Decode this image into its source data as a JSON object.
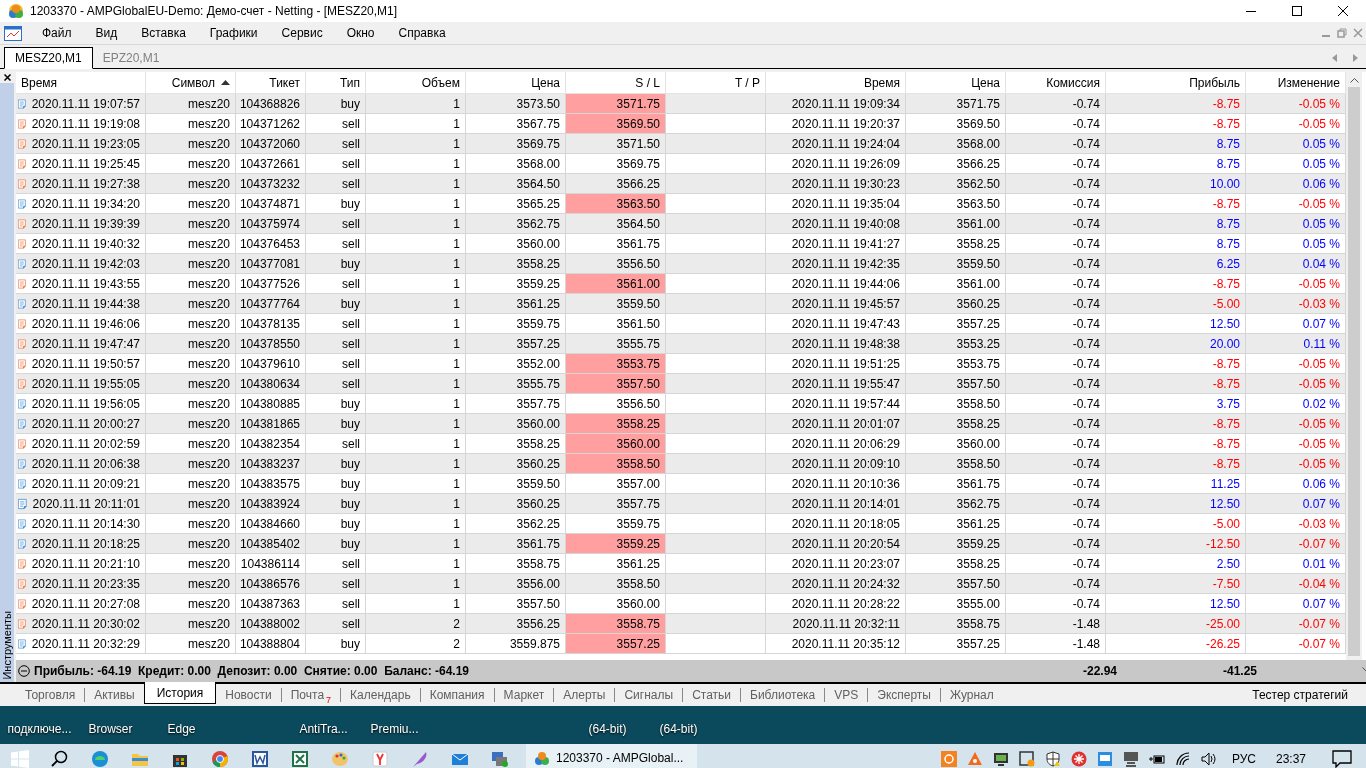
{
  "window": {
    "title": "1203370 - AMPGlobalEU-Demo: Демо-счет - Netting - [MESZ20,M1]"
  },
  "menu": [
    "Файл",
    "Вид",
    "Вставка",
    "Графики",
    "Сервис",
    "Окно",
    "Справка"
  ],
  "chart_tabs": [
    {
      "label": "MESZ20,M1",
      "selected": true
    },
    {
      "label": "EPZ20,M1",
      "selected": false
    }
  ],
  "toolbox": {
    "title": "Инструменты"
  },
  "history": {
    "columns": [
      {
        "label": "Время",
        "sorted": false
      },
      {
        "label": "Символ",
        "sorted": true
      },
      {
        "label": "Тикет",
        "sorted": false
      },
      {
        "label": "Тип",
        "sorted": false
      },
      {
        "label": "Объем",
        "sorted": false
      },
      {
        "label": "Цена",
        "sorted": false
      },
      {
        "label": "S / L",
        "sorted": false
      },
      {
        "label": "T / P",
        "sorted": false
      },
      {
        "label": "Время",
        "sorted": false
      },
      {
        "label": "Цена",
        "sorted": false
      },
      {
        "label": "Комиссия",
        "sorted": false
      },
      {
        "label": "Прибыль",
        "sorted": false
      },
      {
        "label": "Изменение",
        "sorted": false
      }
    ],
    "rows": [
      {
        "kind": "buy",
        "open_time": "2020.11.11 19:07:57",
        "symbol": "mesz20",
        "ticket": "104368826",
        "type": "buy",
        "volume": "1",
        "open_price": "3573.50",
        "sl": "3571.75",
        "sl_hit": true,
        "close_time": "2020.11.11 19:09:34",
        "close_price": "3571.75",
        "commission": "-0.74",
        "profit": "-8.75",
        "change": "-0.05 %",
        "loss": true
      },
      {
        "kind": "sell",
        "open_time": "2020.11.11 19:19:08",
        "symbol": "mesz20",
        "ticket": "104371262",
        "type": "sell",
        "volume": "1",
        "open_price": "3567.75",
        "sl": "3569.50",
        "sl_hit": true,
        "close_time": "2020.11.11 19:20:37",
        "close_price": "3569.50",
        "commission": "-0.74",
        "profit": "-8.75",
        "change": "-0.05 %",
        "loss": true
      },
      {
        "kind": "sell",
        "open_time": "2020.11.11 19:23:05",
        "symbol": "mesz20",
        "ticket": "104372060",
        "type": "sell",
        "volume": "1",
        "open_price": "3569.75",
        "sl": "3571.50",
        "sl_hit": false,
        "close_time": "2020.11.11 19:24:04",
        "close_price": "3568.00",
        "commission": "-0.74",
        "profit": "8.75",
        "change": "0.05 %",
        "loss": false
      },
      {
        "kind": "sell",
        "open_time": "2020.11.11 19:25:45",
        "symbol": "mesz20",
        "ticket": "104372661",
        "type": "sell",
        "volume": "1",
        "open_price": "3568.00",
        "sl": "3569.75",
        "sl_hit": false,
        "close_time": "2020.11.11 19:26:09",
        "close_price": "3566.25",
        "commission": "-0.74",
        "profit": "8.75",
        "change": "0.05 %",
        "loss": false
      },
      {
        "kind": "sell",
        "open_time": "2020.11.11 19:27:38",
        "symbol": "mesz20",
        "ticket": "104373232",
        "type": "sell",
        "volume": "1",
        "open_price": "3564.50",
        "sl": "3566.25",
        "sl_hit": false,
        "close_time": "2020.11.11 19:30:23",
        "close_price": "3562.50",
        "commission": "-0.74",
        "profit": "10.00",
        "change": "0.06 %",
        "loss": false
      },
      {
        "kind": "buy",
        "open_time": "2020.11.11 19:34:20",
        "symbol": "mesz20",
        "ticket": "104374871",
        "type": "buy",
        "volume": "1",
        "open_price": "3565.25",
        "sl": "3563.50",
        "sl_hit": true,
        "close_time": "2020.11.11 19:35:04",
        "close_price": "3563.50",
        "commission": "-0.74",
        "profit": "-8.75",
        "change": "-0.05 %",
        "loss": true
      },
      {
        "kind": "sell",
        "open_time": "2020.11.11 19:39:39",
        "symbol": "mesz20",
        "ticket": "104375974",
        "type": "sell",
        "volume": "1",
        "open_price": "3562.75",
        "sl": "3564.50",
        "sl_hit": false,
        "close_time": "2020.11.11 19:40:08",
        "close_price": "3561.00",
        "commission": "-0.74",
        "profit": "8.75",
        "change": "0.05 %",
        "loss": false
      },
      {
        "kind": "sell",
        "open_time": "2020.11.11 19:40:32",
        "symbol": "mesz20",
        "ticket": "104376453",
        "type": "sell",
        "volume": "1",
        "open_price": "3560.00",
        "sl": "3561.75",
        "sl_hit": false,
        "close_time": "2020.11.11 19:41:27",
        "close_price": "3558.25",
        "commission": "-0.74",
        "profit": "8.75",
        "change": "0.05 %",
        "loss": false
      },
      {
        "kind": "buy",
        "open_time": "2020.11.11 19:42:03",
        "symbol": "mesz20",
        "ticket": "104377081",
        "type": "buy",
        "volume": "1",
        "open_price": "3558.25",
        "sl": "3556.50",
        "sl_hit": false,
        "close_time": "2020.11.11 19:42:35",
        "close_price": "3559.50",
        "commission": "-0.74",
        "profit": "6.25",
        "change": "0.04 %",
        "loss": false
      },
      {
        "kind": "sell",
        "open_time": "2020.11.11 19:43:55",
        "symbol": "mesz20",
        "ticket": "104377526",
        "type": "sell",
        "volume": "1",
        "open_price": "3559.25",
        "sl": "3561.00",
        "sl_hit": true,
        "close_time": "2020.11.11 19:44:06",
        "close_price": "3561.00",
        "commission": "-0.74",
        "profit": "-8.75",
        "change": "-0.05 %",
        "loss": true
      },
      {
        "kind": "buy",
        "open_time": "2020.11.11 19:44:38",
        "symbol": "mesz20",
        "ticket": "104377764",
        "type": "buy",
        "volume": "1",
        "open_price": "3561.25",
        "sl": "3559.50",
        "sl_hit": false,
        "close_time": "2020.11.11 19:45:57",
        "close_price": "3560.25",
        "commission": "-0.74",
        "profit": "-5.00",
        "change": "-0.03 %",
        "loss": true
      },
      {
        "kind": "sell",
        "open_time": "2020.11.11 19:46:06",
        "symbol": "mesz20",
        "ticket": "104378135",
        "type": "sell",
        "volume": "1",
        "open_price": "3559.75",
        "sl": "3561.50",
        "sl_hit": false,
        "close_time": "2020.11.11 19:47:43",
        "close_price": "3557.25",
        "commission": "-0.74",
        "profit": "12.50",
        "change": "0.07 %",
        "loss": false
      },
      {
        "kind": "sell",
        "open_time": "2020.11.11 19:47:47",
        "symbol": "mesz20",
        "ticket": "104378550",
        "type": "sell",
        "volume": "1",
        "open_price": "3557.25",
        "sl": "3555.75",
        "sl_hit": false,
        "close_time": "2020.11.11 19:48:38",
        "close_price": "3553.25",
        "commission": "-0.74",
        "profit": "20.00",
        "change": "0.11 %",
        "loss": false
      },
      {
        "kind": "sell",
        "open_time": "2020.11.11 19:50:57",
        "symbol": "mesz20",
        "ticket": "104379610",
        "type": "sell",
        "volume": "1",
        "open_price": "3552.00",
        "sl": "3553.75",
        "sl_hit": true,
        "close_time": "2020.11.11 19:51:25",
        "close_price": "3553.75",
        "commission": "-0.74",
        "profit": "-8.75",
        "change": "-0.05 %",
        "loss": true
      },
      {
        "kind": "sell",
        "open_time": "2020.11.11 19:55:05",
        "symbol": "mesz20",
        "ticket": "104380634",
        "type": "sell",
        "volume": "1",
        "open_price": "3555.75",
        "sl": "3557.50",
        "sl_hit": true,
        "close_time": "2020.11.11 19:55:47",
        "close_price": "3557.50",
        "commission": "-0.74",
        "profit": "-8.75",
        "change": "-0.05 %",
        "loss": true
      },
      {
        "kind": "buy",
        "open_time": "2020.11.11 19:56:05",
        "symbol": "mesz20",
        "ticket": "104380885",
        "type": "buy",
        "volume": "1",
        "open_price": "3557.75",
        "sl": "3556.50",
        "sl_hit": false,
        "close_time": "2020.11.11 19:57:44",
        "close_price": "3558.50",
        "commission": "-0.74",
        "profit": "3.75",
        "change": "0.02 %",
        "loss": false
      },
      {
        "kind": "buy",
        "open_time": "2020.11.11 20:00:27",
        "symbol": "mesz20",
        "ticket": "104381865",
        "type": "buy",
        "volume": "1",
        "open_price": "3560.00",
        "sl": "3558.25",
        "sl_hit": true,
        "close_time": "2020.11.11 20:01:07",
        "close_price": "3558.25",
        "commission": "-0.74",
        "profit": "-8.75",
        "change": "-0.05 %",
        "loss": true
      },
      {
        "kind": "sell",
        "open_time": "2020.11.11 20:02:59",
        "symbol": "mesz20",
        "ticket": "104382354",
        "type": "sell",
        "volume": "1",
        "open_price": "3558.25",
        "sl": "3560.00",
        "sl_hit": true,
        "close_time": "2020.11.11 20:06:29",
        "close_price": "3560.00",
        "commission": "-0.74",
        "profit": "-8.75",
        "change": "-0.05 %",
        "loss": true
      },
      {
        "kind": "buy",
        "open_time": "2020.11.11 20:06:38",
        "symbol": "mesz20",
        "ticket": "104383237",
        "type": "buy",
        "volume": "1",
        "open_price": "3560.25",
        "sl": "3558.50",
        "sl_hit": true,
        "close_time": "2020.11.11 20:09:10",
        "close_price": "3558.50",
        "commission": "-0.74",
        "profit": "-8.75",
        "change": "-0.05 %",
        "loss": true
      },
      {
        "kind": "buy",
        "open_time": "2020.11.11 20:09:21",
        "symbol": "mesz20",
        "ticket": "104383575",
        "type": "buy",
        "volume": "1",
        "open_price": "3559.50",
        "sl": "3557.00",
        "sl_hit": false,
        "close_time": "2020.11.11 20:10:36",
        "close_price": "3561.75",
        "commission": "-0.74",
        "profit": "11.25",
        "change": "0.06 %",
        "loss": false
      },
      {
        "kind": "buy",
        "open_time": "2020.11.11 20:11:01",
        "symbol": "mesz20",
        "ticket": "104383924",
        "type": "buy",
        "volume": "1",
        "open_price": "3560.25",
        "sl": "3557.75",
        "sl_hit": false,
        "close_time": "2020.11.11 20:14:01",
        "close_price": "3562.75",
        "commission": "-0.74",
        "profit": "12.50",
        "change": "0.07 %",
        "loss": false
      },
      {
        "kind": "buy",
        "open_time": "2020.11.11 20:14:30",
        "symbol": "mesz20",
        "ticket": "104384660",
        "type": "buy",
        "volume": "1",
        "open_price": "3562.25",
        "sl": "3559.75",
        "sl_hit": false,
        "close_time": "2020.11.11 20:18:05",
        "close_price": "3561.25",
        "commission": "-0.74",
        "profit": "-5.00",
        "change": "-0.03 %",
        "loss": true
      },
      {
        "kind": "buy",
        "open_time": "2020.11.11 20:18:25",
        "symbol": "mesz20",
        "ticket": "104385402",
        "type": "buy",
        "volume": "1",
        "open_price": "3561.75",
        "sl": "3559.25",
        "sl_hit": true,
        "close_time": "2020.11.11 20:20:54",
        "close_price": "3559.25",
        "commission": "-0.74",
        "profit": "-12.50",
        "change": "-0.07 %",
        "loss": true
      },
      {
        "kind": "sell",
        "open_time": "2020.11.11 20:21:10",
        "symbol": "mesz20",
        "ticket": "104386114",
        "type": "sell",
        "volume": "1",
        "open_price": "3558.75",
        "sl": "3561.25",
        "sl_hit": false,
        "close_time": "2020.11.11 20:23:07",
        "close_price": "3558.25",
        "commission": "-0.74",
        "profit": "2.50",
        "change": "0.01 %",
        "loss": false
      },
      {
        "kind": "sell",
        "open_time": "2020.11.11 20:23:35",
        "symbol": "mesz20",
        "ticket": "104386576",
        "type": "sell",
        "volume": "1",
        "open_price": "3556.00",
        "sl": "3558.50",
        "sl_hit": false,
        "close_time": "2020.11.11 20:24:32",
        "close_price": "3557.50",
        "commission": "-0.74",
        "profit": "-7.50",
        "change": "-0.04 %",
        "loss": true
      },
      {
        "kind": "sell",
        "open_time": "2020.11.11 20:27:08",
        "symbol": "mesz20",
        "ticket": "104387363",
        "type": "sell",
        "volume": "1",
        "open_price": "3557.50",
        "sl": "3560.00",
        "sl_hit": false,
        "close_time": "2020.11.11 20:28:22",
        "close_price": "3555.00",
        "commission": "-0.74",
        "profit": "12.50",
        "change": "0.07 %",
        "loss": false
      },
      {
        "kind": "sell",
        "open_time": "2020.11.11 20:30:02",
        "symbol": "mesz20",
        "ticket": "104388002",
        "type": "sell",
        "volume": "2",
        "open_price": "3556.25",
        "sl": "3558.75",
        "sl_hit": true,
        "close_time": "2020.11.11 20:32:11",
        "close_price": "3558.75",
        "commission": "-1.48",
        "profit": "-25.00",
        "change": "-0.07 %",
        "loss": true
      },
      {
        "kind": "buy",
        "open_time": "2020.11.11 20:32:29",
        "symbol": "mesz20",
        "ticket": "104388804",
        "type": "buy",
        "volume": "2",
        "open_price": "3559.875",
        "sl": "3557.25",
        "sl_hit": true,
        "close_time": "2020.11.11 20:35:12",
        "close_price": "3557.25",
        "commission": "-1.48",
        "profit": "-26.25",
        "change": "-0.07 %",
        "loss": true
      }
    ],
    "summary": {
      "text": "Прибыль: -64.19  Кредит: 0.00  Депозит: 0.00  Снятие: 0.00  Баланс: -64.19",
      "commission": "-22.94",
      "profit": "-41.25"
    }
  },
  "bottom_tabs": [
    {
      "label": "Торговля",
      "selected": false
    },
    {
      "label": "Активы",
      "selected": false
    },
    {
      "label": "История",
      "selected": true
    },
    {
      "label": "Новости",
      "selected": false
    },
    {
      "label": "Почта",
      "selected": false,
      "badge": "7"
    },
    {
      "label": "Календарь",
      "selected": false
    },
    {
      "label": "Компания",
      "selected": false
    },
    {
      "label": "Маркет",
      "selected": false
    },
    {
      "label": "Алерты",
      "selected": false
    },
    {
      "label": "Сигналы",
      "selected": false
    },
    {
      "label": "Статьи",
      "selected": false
    },
    {
      "label": "Библиотека",
      "selected": false
    },
    {
      "label": "VPS",
      "selected": false
    },
    {
      "label": "Эксперты",
      "selected": false
    },
    {
      "label": "Журнал",
      "selected": false
    }
  ],
  "strategy_tester": "Тестер стратегий",
  "desktop_icons": [
    "подключе...",
    "Browser",
    "Edge",
    "AntiTra...",
    "Premiu...",
    "(64-bit)",
    "(64-bit)"
  ],
  "taskbar": {
    "active_window": "1203370 - AMPGlobal...",
    "language": "РУС",
    "time": "23:37"
  }
}
